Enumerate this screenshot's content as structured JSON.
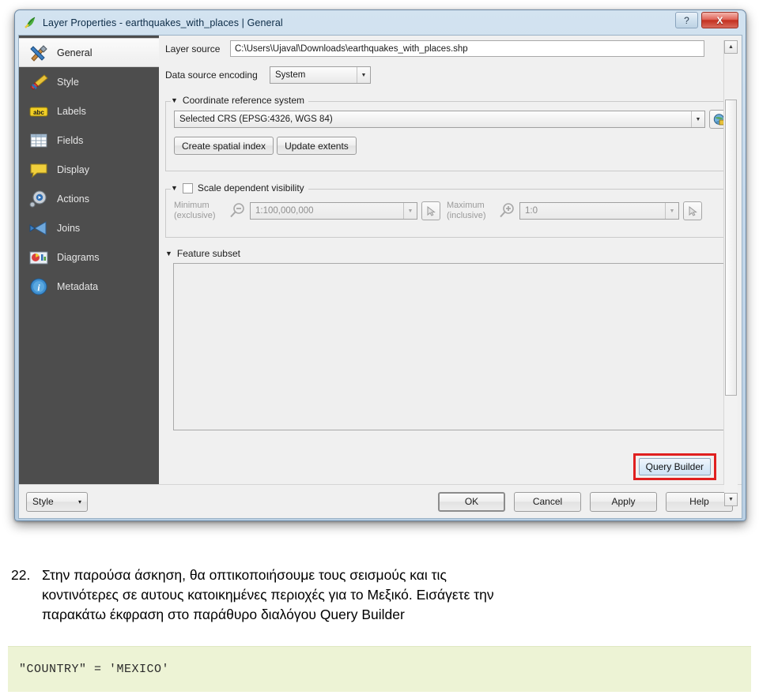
{
  "dialog": {
    "title": "Layer Properties - earthquakes_with_places | General",
    "title_icon": "qgis-leaf-icon",
    "help_button": "?",
    "close_button": "X"
  },
  "sidebar": {
    "items": [
      {
        "label": "General",
        "icon": "tools-icon",
        "selected": true
      },
      {
        "label": "Style",
        "icon": "brush-icon",
        "selected": false
      },
      {
        "label": "Labels",
        "icon": "abc-label-icon",
        "selected": false
      },
      {
        "label": "Fields",
        "icon": "table-icon",
        "selected": false
      },
      {
        "label": "Display",
        "icon": "speech-bubble-icon",
        "selected": false
      },
      {
        "label": "Actions",
        "icon": "gear-play-icon",
        "selected": false
      },
      {
        "label": "Joins",
        "icon": "join-arrow-icon",
        "selected": false
      },
      {
        "label": "Diagrams",
        "icon": "chart-image-icon",
        "selected": false
      },
      {
        "label": "Metadata",
        "icon": "info-circle-icon",
        "selected": false
      }
    ]
  },
  "general": {
    "layer_source_label": "Layer source",
    "layer_source_value": "C:\\Users\\Ujaval\\Downloads\\earthquakes_with_places.shp",
    "encoding_label": "Data source encoding",
    "encoding_value": "System"
  },
  "crs": {
    "group_title": "Coordinate reference system",
    "selected_value": "Selected CRS (EPSG:4326, WGS 84)",
    "globe_icon": "globe-crs-icon",
    "create_spatial_index": "Create spatial index",
    "update_extents": "Update extents"
  },
  "scale_visibility": {
    "group_title": "Scale dependent visibility",
    "checked": false,
    "minimum_label_1": "Minimum",
    "minimum_label_2": "(exclusive)",
    "minimum_value": "1:100,000,000",
    "minimum_icon": "magnifier-minus-icon",
    "maximum_label_1": "Maximum",
    "maximum_label_2": "(inclusive)",
    "maximum_value": "1:0",
    "maximum_icon": "magnifier-plus-icon",
    "pick_icon": "set-from-canvas-icon"
  },
  "feature_subset": {
    "group_title": "Feature subset",
    "text_value": "",
    "query_builder_label": "Query Builder",
    "highlight_color": "#e02020",
    "cursor_icon": "mouse-pointer-icon"
  },
  "footer": {
    "style_label": "Style",
    "style_arrow": "▾",
    "ok": "OK",
    "cancel": "Cancel",
    "apply": "Apply",
    "help": "Help"
  },
  "instruction": {
    "number": "22.",
    "line1": "Στην παρούσα άσκηση, θα οπτικοποιήσουμε τους σεισμούς και τις",
    "line2": "κοντινότερες σε αυτους κατοικημένες περιοχές για το Μεξικό. Εισάγετε την",
    "line3": "παρακάτω έκφραση στο παράθυρο διαλόγου Query Builder"
  },
  "code": {
    "expression": "\"COUNTRY\" = 'MEXICO'",
    "background": "#edf3d5"
  }
}
